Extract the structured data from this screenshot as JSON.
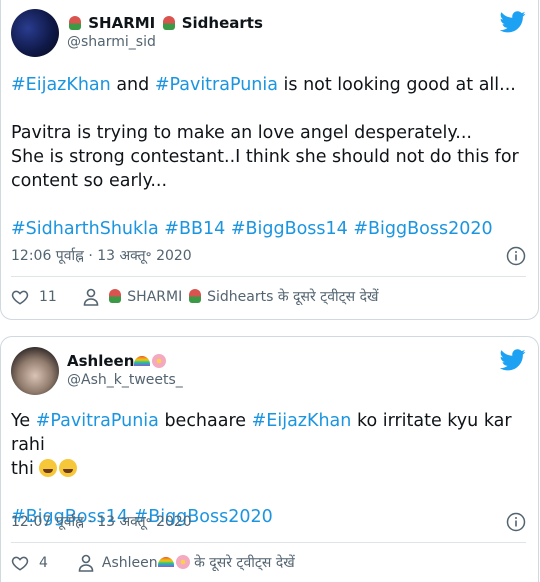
{
  "tweets": [
    {
      "name_part1": "SHARMI",
      "name_part2": "Sidhearts",
      "handle": "@sharmi_sid",
      "body": {
        "line1_tag1": "#EijazKhan",
        "line1_mid": " and ",
        "line1_tag2": "#PavitraPunia",
        "line1_end": " is not looking good at all...",
        "para2": "Pavitra is trying to make an love angel desperately...",
        "para3": "She is strong contestant..I think she should not do this for content so early...",
        "hashtags": [
          "#SidharthShukla",
          "#BB14",
          "#BiggBoss14",
          "#BiggBoss2020"
        ]
      },
      "timestamp": "12:06 पूर्वाह्न · 13 अक्तू॰ 2020",
      "like_count": "11",
      "more_tweets_name1": "SHARMI",
      "more_tweets_name2": "Sidhearts",
      "more_tweets_suffix": "के दूसरे ट्वीट्स देखें"
    },
    {
      "name": "Ashleen",
      "handle": "@Ash_k_tweets_",
      "body": {
        "prefix": "Ye ",
        "tag1": "#PavitraPunia",
        "mid1": " bechaare ",
        "tag2": "#EijazKhan",
        "rest_line1": " ko irritate kyu kar rahi",
        "line2": "thi",
        "hashtags": [
          "#BiggBoss14",
          "#BiggBoss2020"
        ]
      },
      "timestamp": "12:07 पूर्वाह्न · 13 अक्तू॰ 2020",
      "like_count": "4",
      "more_tweets_name": "Ashleen",
      "more_tweets_suffix": "के दूसरे ट्वीट्स देखें"
    }
  ],
  "icons": {
    "twitter": "twitter-bird-icon",
    "info": "info-icon",
    "like": "heart-icon",
    "user": "user-icon"
  },
  "colors": {
    "link": "#1b95e0",
    "twitter_blue": "#1da1f2",
    "secondary_text": "#536471",
    "border": "#cfd9de"
  }
}
